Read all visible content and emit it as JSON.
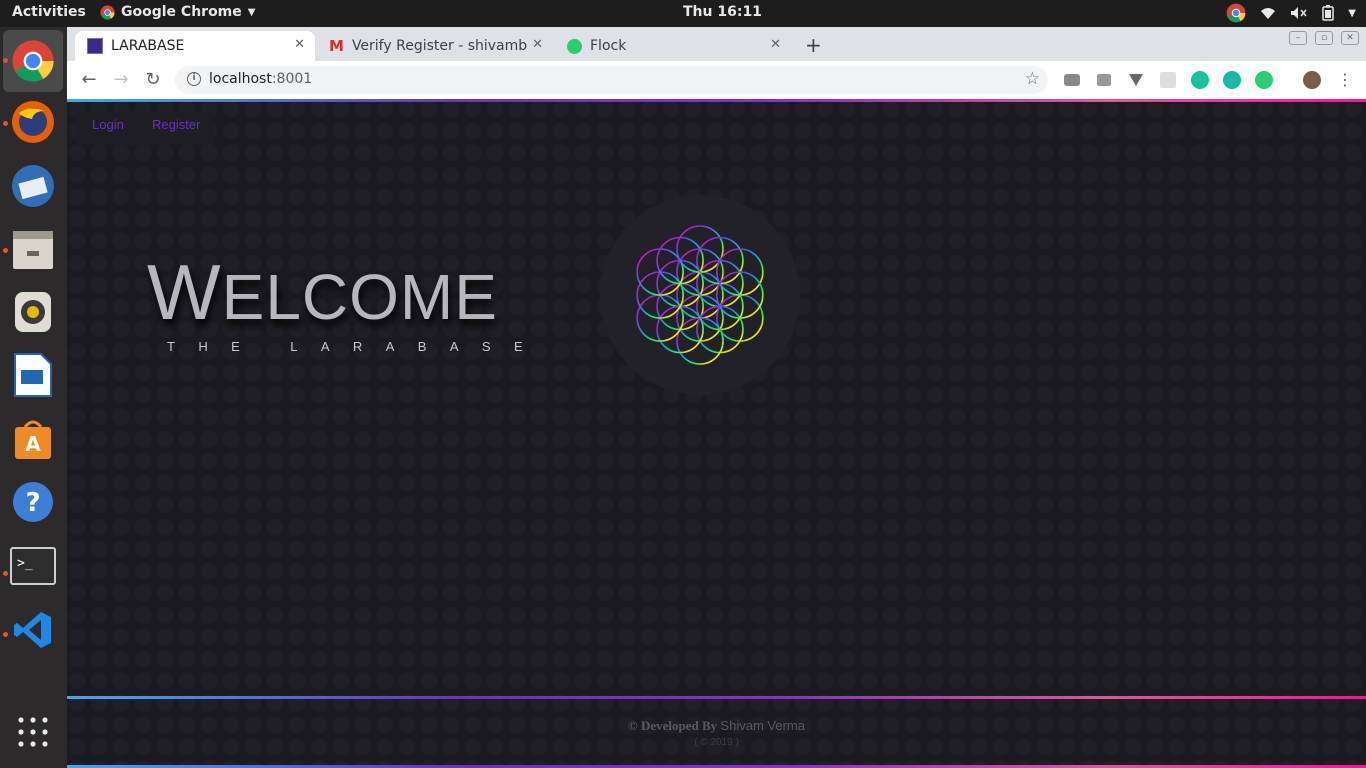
{
  "topbar": {
    "activities": "Activities",
    "app_name": "Google Chrome",
    "clock": "Thu 16:11"
  },
  "tabs": [
    {
      "title": "LARABASE",
      "active": true
    },
    {
      "title": "Verify Register - shivambo",
      "active": false
    },
    {
      "title": "Flock",
      "active": false
    }
  ],
  "toolbar": {
    "url_host": "localhost",
    "url_port": ":8001"
  },
  "page": {
    "nav": {
      "login": "Login",
      "register": "Register"
    },
    "welcome_first": "W",
    "welcome_rest": "ELCOME",
    "subtitle": "THE LARABASE",
    "footer_prefix": "© Developed By",
    "footer_name": "Shivam Verma",
    "footer_year": "( © 2019 )"
  },
  "colors": {
    "accent_link": "#6a2fc0",
    "background": "#1b1a20"
  }
}
